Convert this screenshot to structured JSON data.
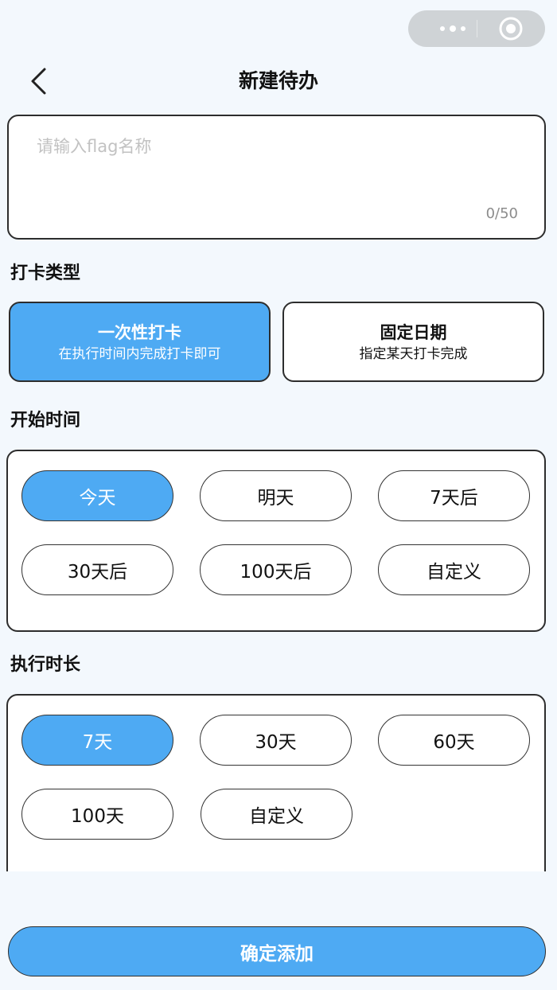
{
  "header": {
    "title": "新建待办",
    "back_icon": "chevron-left-icon"
  },
  "capsule": {
    "more_icon": "more-dots-icon",
    "close_icon": "target-circle-icon"
  },
  "name_input": {
    "placeholder": "请输入flag名称",
    "counter": "0/50"
  },
  "checkin_type": {
    "label": "打卡类型",
    "options": [
      {
        "title": "一次性打卡",
        "desc": "在执行时间内完成打卡即可",
        "selected": true
      },
      {
        "title": "固定日期",
        "desc": "指定某天打卡完成",
        "selected": false
      }
    ]
  },
  "start_time": {
    "label": "开始时间",
    "options": [
      "今天",
      "明天",
      "7天后",
      "30天后",
      "100天后",
      "自定义"
    ],
    "selected": "今天"
  },
  "duration": {
    "label": "执行时长",
    "options": [
      "7天",
      "30天",
      "60天",
      "100天",
      "自定义"
    ],
    "selected": "7天"
  },
  "confirm_button": {
    "label": "确定添加"
  },
  "colors": {
    "accent": "#4eaaf3",
    "background": "#f3f8fd",
    "border": "#2d2d2d"
  }
}
